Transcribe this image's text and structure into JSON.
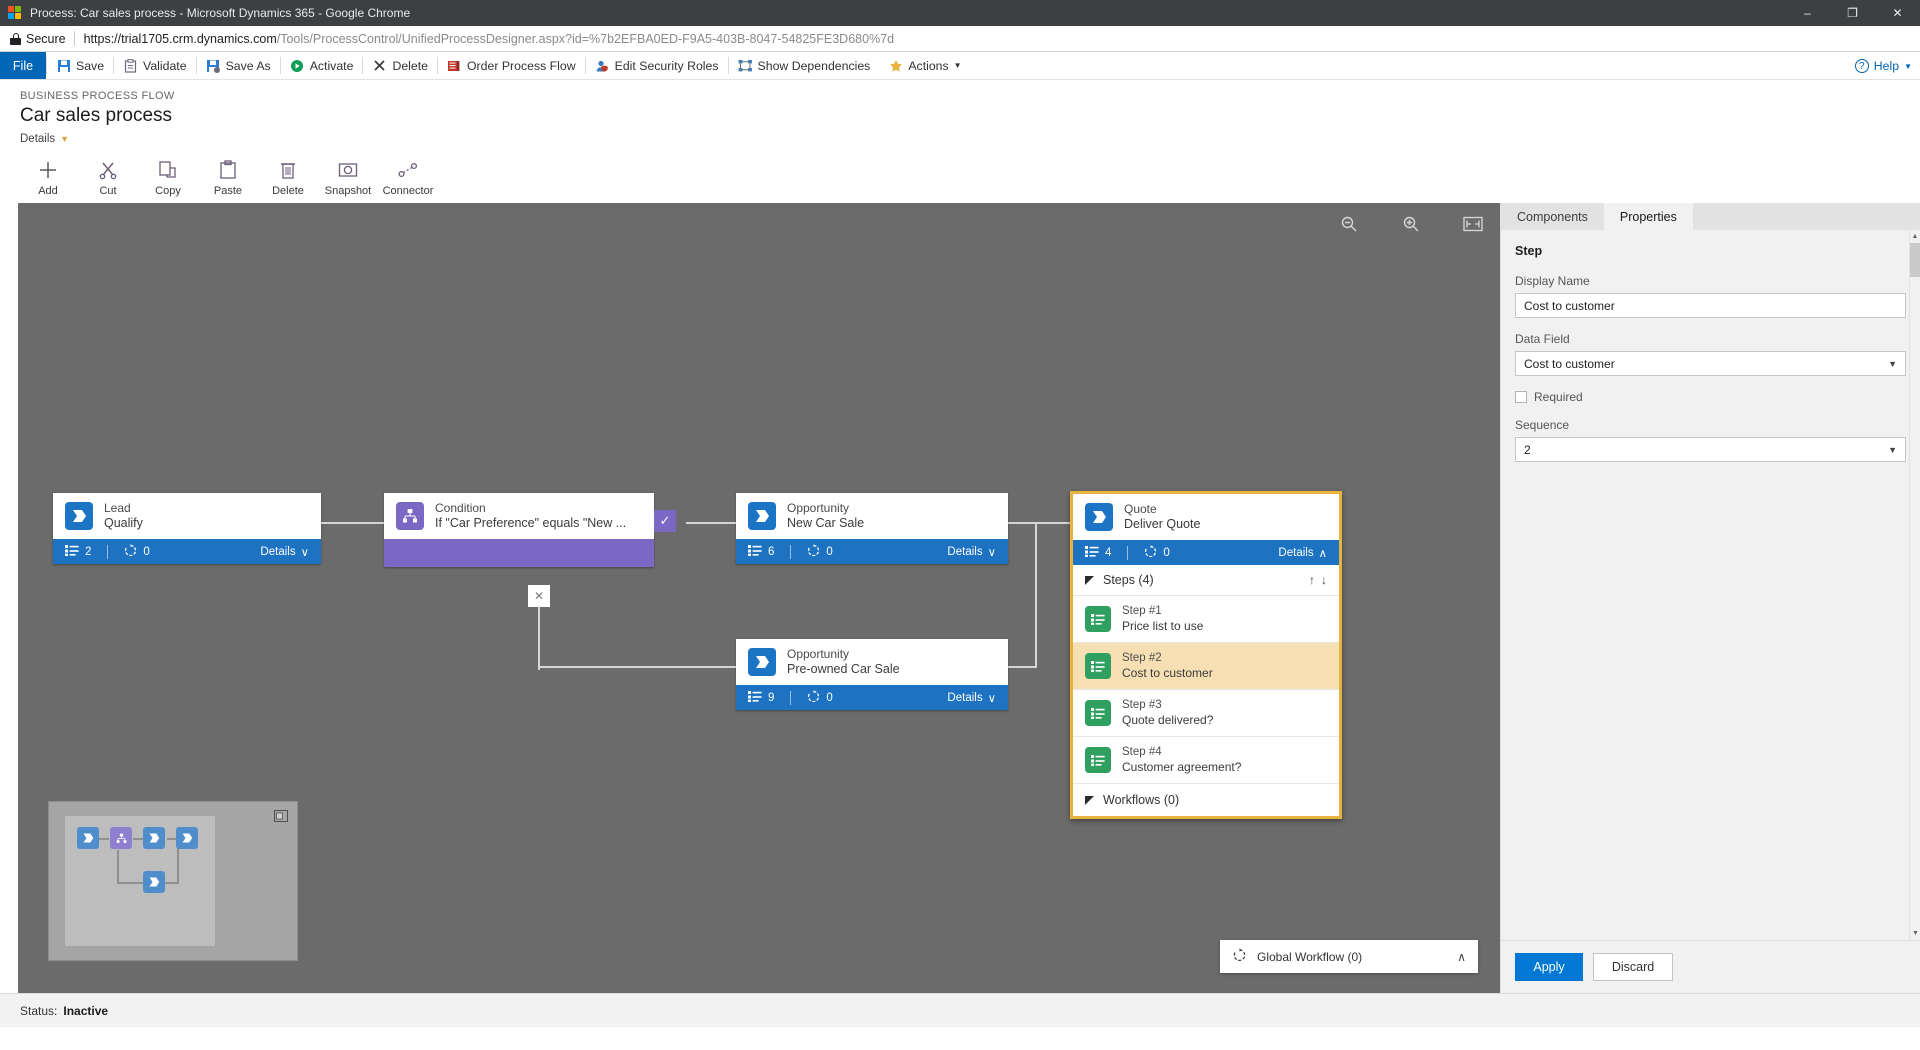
{
  "browser": {
    "title": "Process: Car sales process - Microsoft Dynamics 365 - Google Chrome",
    "secure_label": "Secure",
    "url_host": "https://trial1705.crm.dynamics.com",
    "url_path": "/Tools/ProcessControl/UnifiedProcessDesigner.aspx?id=%7b2EFBA0ED-F9A5-403B-8047-54825FE3D680%7d",
    "minimize": "–",
    "maximize": "❐",
    "close": "✕"
  },
  "command_bar": {
    "file": "File",
    "items": [
      {
        "label": "Save",
        "icon": "save-icon"
      },
      {
        "label": "Validate",
        "icon": "validate-icon"
      },
      {
        "label": "Save As",
        "icon": "save-as-icon"
      },
      {
        "label": "Activate",
        "icon": "activate-icon"
      },
      {
        "label": "Delete",
        "icon": "delete-icon"
      },
      {
        "label": "Order Process Flow",
        "icon": "order-process-flow-icon"
      },
      {
        "label": "Edit Security Roles",
        "icon": "edit-security-roles-icon"
      },
      {
        "label": "Show Dependencies",
        "icon": "show-dependencies-icon"
      },
      {
        "label": "Actions",
        "icon": "actions-icon"
      }
    ],
    "help": "Help"
  },
  "header": {
    "kicker": "BUSINESS PROCESS FLOW",
    "title": "Car sales process",
    "details_link": "Details"
  },
  "design_toolbar": [
    {
      "label": "Add",
      "icon": "plus-icon"
    },
    {
      "label": "Cut",
      "icon": "scissors-icon"
    },
    {
      "label": "Copy",
      "icon": "copy-icon"
    },
    {
      "label": "Paste",
      "icon": "paste-icon"
    },
    {
      "label": "Delete",
      "icon": "trash-icon"
    },
    {
      "label": "Snapshot",
      "icon": "camera-icon"
    },
    {
      "label": "Connector",
      "icon": "connector-icon"
    }
  ],
  "canvas": {
    "zoom_out": "zoom-out-icon",
    "zoom_in": "zoom-in-icon",
    "fit": "fit-to-screen-icon",
    "nodes": {
      "lead": {
        "type": "Lead",
        "name": "Qualify",
        "steps_count": "2",
        "workflows_count": "0",
        "details": "Details",
        "chevron": "∨"
      },
      "condition": {
        "type": "Condition",
        "name": "If \"Car Preference\" equals \"New ...",
        "yes_badge": "✓",
        "no_badge": "✕"
      },
      "opportunity_new": {
        "type": "Opportunity",
        "name": "New Car Sale",
        "steps_count": "6",
        "workflows_count": "0",
        "details": "Details",
        "chevron": "∨"
      },
      "opportunity_preowned": {
        "type": "Opportunity",
        "name": "Pre-owned Car Sale",
        "steps_count": "9",
        "workflows_count": "0",
        "details": "Details",
        "chevron": "∨"
      },
      "quote": {
        "type": "Quote",
        "name": "Deliver Quote",
        "steps_count": "4",
        "workflows_count": "0",
        "details": "Details",
        "chevron": "∧",
        "steps_header": "Steps (4)",
        "move_up": "↑",
        "move_down": "↓",
        "steps": [
          {
            "index": "Step #1",
            "name": "Price list to use",
            "selected": false
          },
          {
            "index": "Step #2",
            "name": "Cost to customer",
            "selected": true
          },
          {
            "index": "Step #3",
            "name": "Quote delivered?",
            "selected": false
          },
          {
            "index": "Step #4",
            "name": "Customer agreement?",
            "selected": false
          }
        ],
        "workflows_header": "Workflows (0)"
      }
    },
    "global_workflow": {
      "label": "Global Workflow (0)",
      "chevron": "∧",
      "icon": "workflow-icon"
    },
    "minimap": {
      "expand_icon": "expand-minimap-icon"
    }
  },
  "right_panel": {
    "tabs": [
      {
        "label": "Components",
        "active": false
      },
      {
        "label": "Properties",
        "active": true
      }
    ],
    "section_title": "Step",
    "display_name_label": "Display Name",
    "display_name_value": "Cost to customer",
    "data_field_label": "Data Field",
    "data_field_value": "Cost to customer",
    "required_label": "Required",
    "required_checked": false,
    "sequence_label": "Sequence",
    "sequence_value": "2",
    "apply": "Apply",
    "discard": "Discard"
  },
  "status_bar": {
    "label": "Status:",
    "value": "Inactive"
  },
  "colors": {
    "accent_blue": "#1d72c2",
    "condition_purple": "#7b68c4",
    "step_green": "#2fa060",
    "selection_gold": "#e8b33c",
    "selected_row": "#f6dfb2",
    "apply_blue": "#0078d4"
  }
}
